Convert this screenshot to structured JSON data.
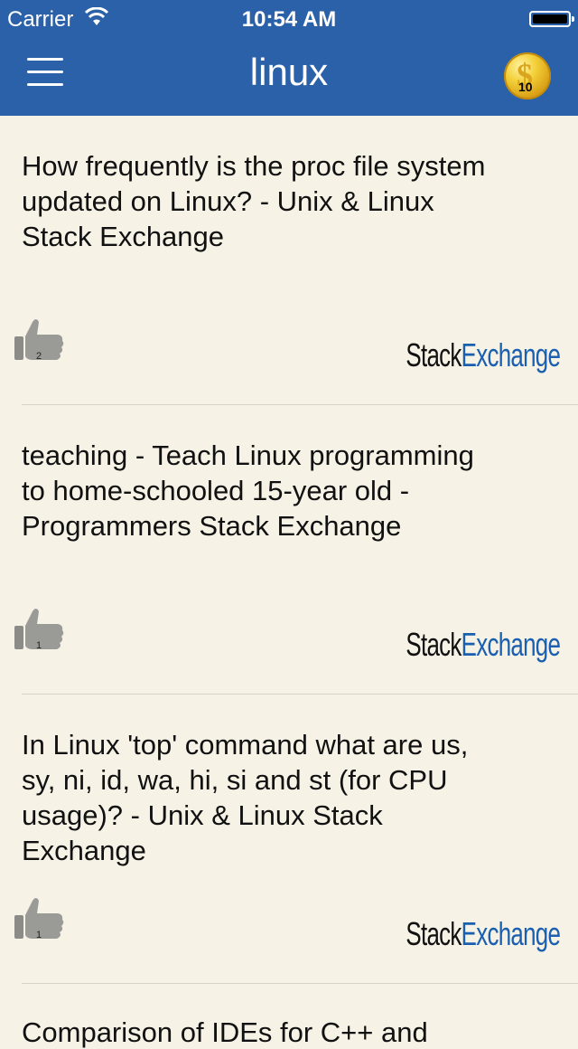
{
  "status_bar": {
    "carrier": "Carrier",
    "time": "10:54 AM"
  },
  "header": {
    "title": "linux",
    "coins": "10"
  },
  "items": [
    {
      "text": "How frequently is the proc file system updated on Linux? - Unix & Linux Stack Exchange",
      "likes": "2",
      "brand_a": "Stack",
      "brand_b": "Exchange"
    },
    {
      "text": "teaching - Teach Linux programming to home-schooled 15-year old - Programmers Stack Exchange",
      "likes": "1",
      "brand_a": "Stack",
      "brand_b": "Exchange"
    },
    {
      "text": "In Linux 'top' command what are us, sy, ni, id, wa, hi, si and st (for CPU usage)? - Unix & Linux Stack Exchange",
      "likes": "1",
      "brand_a": "Stack",
      "brand_b": "Exchange"
    }
  ],
  "partial_item": {
    "text": "Comparison of IDEs for C++ and"
  },
  "colors": {
    "header": "#2a61a8",
    "background": "#f6f2e6",
    "brand_blue": "#1b5fb0"
  }
}
